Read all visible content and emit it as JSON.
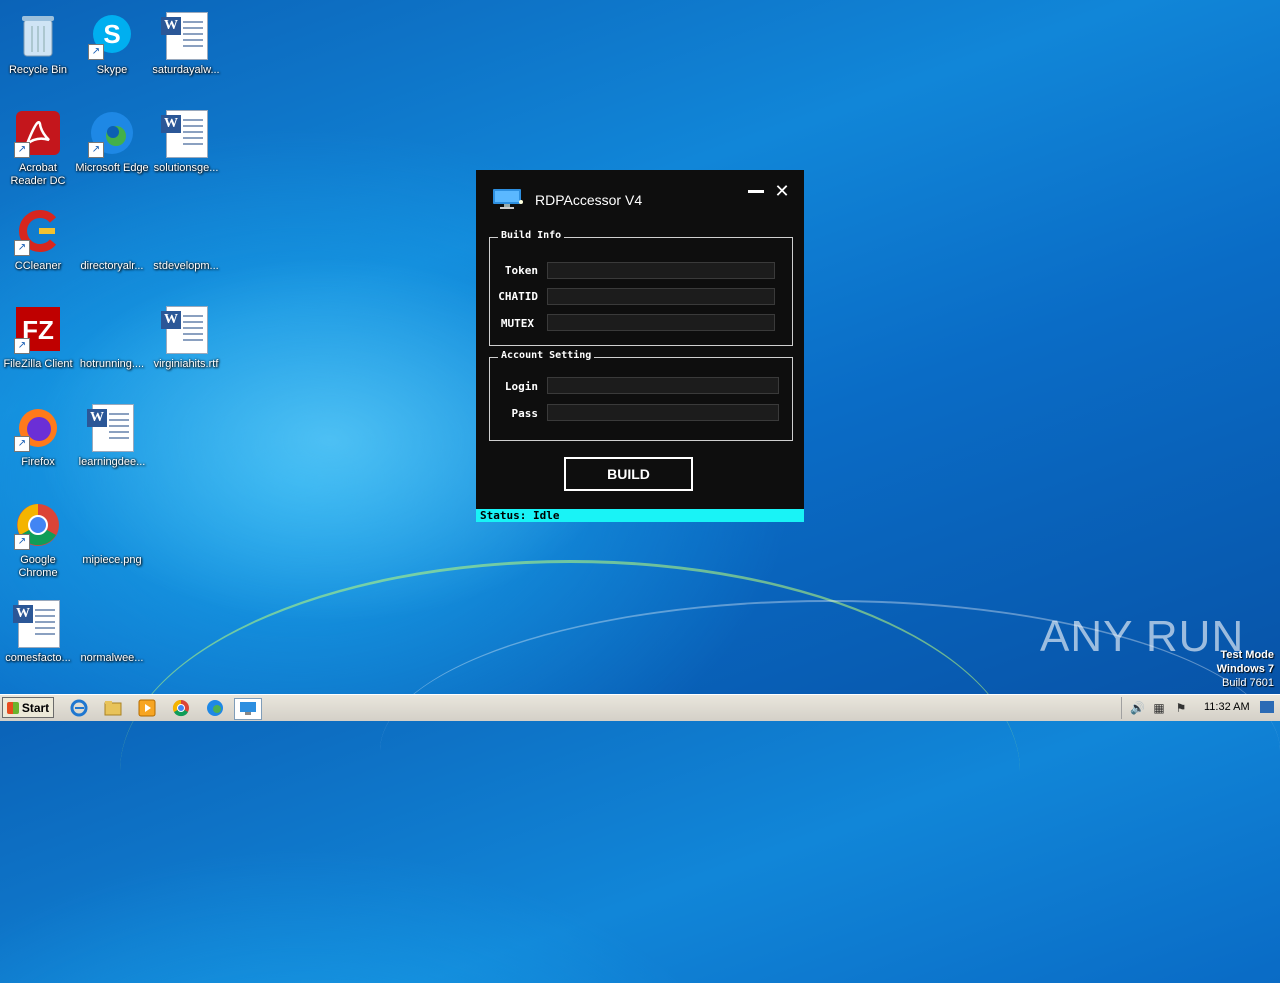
{
  "desktop": {
    "icons": [
      {
        "label": "Recycle Bin",
        "icon": "recycle-bin-icon"
      },
      {
        "label": "Skype",
        "icon": "skype-icon"
      },
      {
        "label": "saturdayalw...",
        "icon": "word-document-icon"
      },
      {
        "label": "Acrobat Reader DC",
        "icon": "acrobat-icon"
      },
      {
        "label": "Microsoft Edge",
        "icon": "edge-icon"
      },
      {
        "label": "solutionsge...",
        "icon": "word-document-icon"
      },
      {
        "label": "CCleaner",
        "icon": "ccleaner-icon"
      },
      {
        "label": "directoryalr...",
        "icon": "blank-file-icon"
      },
      {
        "label": "stdevelopm...",
        "icon": "blank-file-icon"
      },
      {
        "label": "FileZilla Client",
        "icon": "filezilla-icon"
      },
      {
        "label": "hotrunning....",
        "icon": "blank-file-icon"
      },
      {
        "label": "virginiahits.rtf",
        "icon": "word-document-icon"
      },
      {
        "label": "Firefox",
        "icon": "firefox-icon"
      },
      {
        "label": "learningdee...",
        "icon": "word-document-icon"
      },
      {
        "label": "Google Chrome",
        "icon": "chrome-icon"
      },
      {
        "label": "mipiece.png",
        "icon": "blank-file-icon"
      },
      {
        "label": "comesfacto...",
        "icon": "word-document-icon"
      },
      {
        "label": "normalwee...",
        "icon": "blank-file-icon"
      }
    ]
  },
  "app": {
    "title": "RDPAccessor V4",
    "build_info": {
      "legend": "Build Info",
      "token_label": "Token",
      "token_value": "",
      "chatid_label": "CHATID",
      "chatid_value": "",
      "mutex_label": "MUTEX",
      "mutex_value": ""
    },
    "account_setting": {
      "legend": "Account Setting",
      "login_label": "Login",
      "login_value": "",
      "pass_label": "Pass",
      "pass_value": ""
    },
    "build_button": "BUILD",
    "status": "Status:  Idle",
    "accent_color": "#19f3f6"
  },
  "watermark": {
    "text": "ANY RUN",
    "test_mode": "Test Mode",
    "os": "Windows 7",
    "build": "Build 7601"
  },
  "taskbar": {
    "start_label": "Start",
    "clock": "11:32 AM",
    "pinned": [
      "internet-explorer-icon",
      "folder-icon",
      "media-player-icon",
      "chrome-icon",
      "edge-icon",
      "rdpaccessor-icon"
    ]
  }
}
